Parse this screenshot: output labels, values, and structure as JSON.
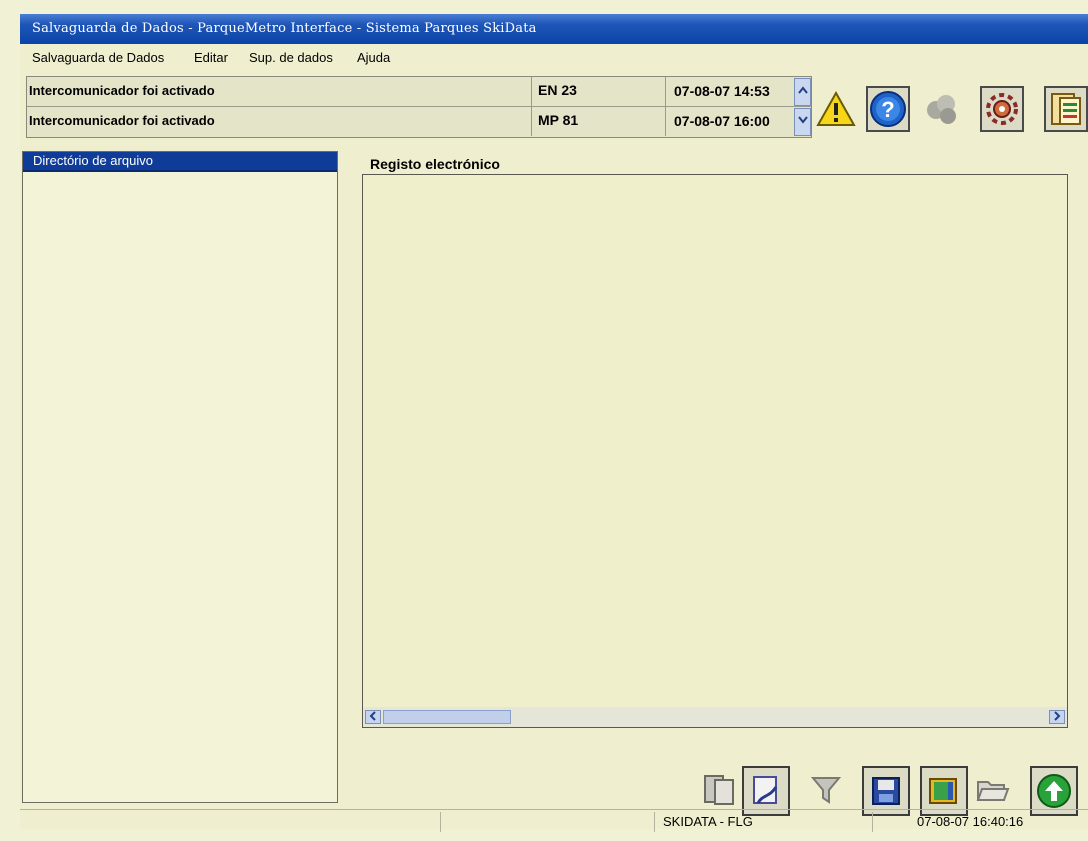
{
  "window": {
    "title": "Salvaguarda de Dados - ParqueMetro Interface - Sistema Parques SkiData"
  },
  "menu": [
    "Salvaguarda de Dados",
    "Editar",
    "Sup. de dados",
    "Ajuda"
  ],
  "alarms": [
    {
      "message": "Intercomunicador foi activado",
      "device": "EN 23",
      "time": "07-08-07 14:53"
    },
    {
      "message": "Intercomunicador foi activado",
      "device": "MP 81",
      "time": "07-08-07 16:00"
    }
  ],
  "toolbar_icons": [
    "warning-icon",
    "help-icon",
    "network-icon",
    "settings-gear-icon",
    "report-icon"
  ],
  "directory": {
    "header": "Directório de arquivo"
  },
  "electronic_log": {
    "title": "Registo electrónico"
  },
  "bottom_icons": [
    "copy-icon",
    "print-icon",
    "filter-icon",
    "save-disk-icon",
    "notebook-icon",
    "open-folder-icon",
    "up-arrow-icon"
  ],
  "status": {
    "system": "SKIDATA - FLG",
    "datetime": "07-08-07 16:40:16"
  },
  "colors": {
    "titlebar": "#0b44a8",
    "background": "#f1f1d6",
    "header_blue": "#0e3c98",
    "warning_yellow": "#f6d619",
    "help_blue": "#1e63c8",
    "up_green": "#2aa23a"
  }
}
